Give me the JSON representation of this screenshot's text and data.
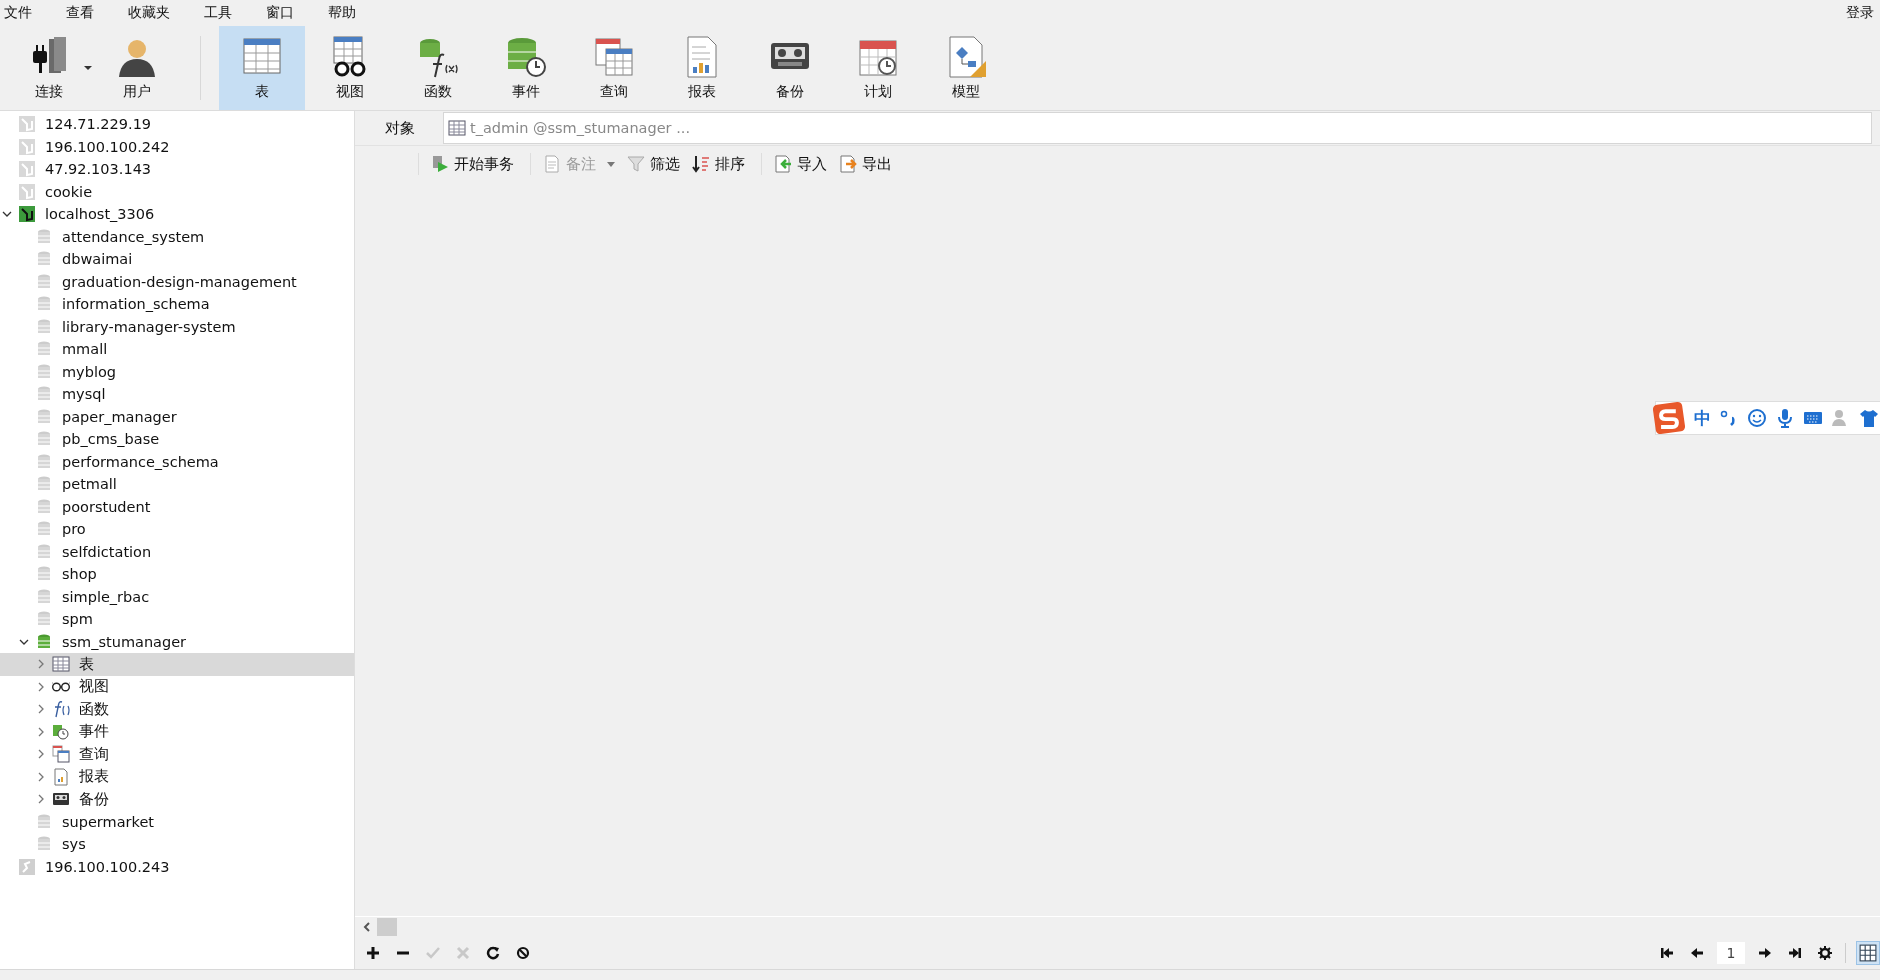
{
  "menu": [
    {
      "label": "文件"
    },
    {
      "label": "查看"
    },
    {
      "label": "收藏夹"
    },
    {
      "label": "工具"
    },
    {
      "label": "窗口"
    },
    {
      "label": "帮助"
    }
  ],
  "login": "登录",
  "toolbar": [
    {
      "label": "连接",
      "kind": "connection",
      "selected": false,
      "dropdown": true
    },
    {
      "label": "用户",
      "kind": "user",
      "selected": false,
      "dropdown": false
    },
    {
      "label": "表",
      "kind": "table",
      "selected": true,
      "dropdown": false
    },
    {
      "label": "视图",
      "kind": "view",
      "selected": false,
      "dropdown": false
    },
    {
      "label": "函数",
      "kind": "function",
      "selected": false,
      "dropdown": false
    },
    {
      "label": "事件",
      "kind": "event",
      "selected": false,
      "dropdown": false
    },
    {
      "label": "查询",
      "kind": "query",
      "selected": false,
      "dropdown": false
    },
    {
      "label": "报表",
      "kind": "report",
      "selected": false,
      "dropdown": false
    },
    {
      "label": "备份",
      "kind": "backup",
      "selected": false,
      "dropdown": false
    },
    {
      "label": "计划",
      "kind": "schedule",
      "selected": false,
      "dropdown": false
    },
    {
      "label": "模型",
      "kind": "model",
      "selected": false,
      "dropdown": false
    }
  ],
  "tree": [
    {
      "label": "124.71.229.19",
      "kind": "server",
      "selected": false
    },
    {
      "label": "196.100.100.242",
      "kind": "server",
      "selected": false
    },
    {
      "label": "47.92.103.143",
      "kind": "server",
      "selected": false
    },
    {
      "label": "cookie",
      "kind": "server",
      "selected": false
    },
    {
      "label": "localhost_3306",
      "kind": "server-open",
      "selected": false,
      "expanded": true,
      "children": [
        {
          "label": "attendance_system",
          "kind": "database",
          "selected": false
        },
        {
          "label": "dbwaimai",
          "kind": "database",
          "selected": false
        },
        {
          "label": "graduation-design-management",
          "kind": "database",
          "selected": false
        },
        {
          "label": "information_schema",
          "kind": "database",
          "selected": false
        },
        {
          "label": "library-manager-system",
          "kind": "database",
          "selected": false
        },
        {
          "label": "mmall",
          "kind": "database",
          "selected": false
        },
        {
          "label": "myblog",
          "kind": "database",
          "selected": false
        },
        {
          "label": "mysql",
          "kind": "database",
          "selected": false
        },
        {
          "label": "paper_manager",
          "kind": "database",
          "selected": false
        },
        {
          "label": "pb_cms_base",
          "kind": "database",
          "selected": false
        },
        {
          "label": "performance_schema",
          "kind": "database",
          "selected": false
        },
        {
          "label": "petmall",
          "kind": "database",
          "selected": false
        },
        {
          "label": "poorstudent",
          "kind": "database",
          "selected": false
        },
        {
          "label": "pro",
          "kind": "database",
          "selected": false
        },
        {
          "label": "selfdictation",
          "kind": "database",
          "selected": false
        },
        {
          "label": "shop",
          "kind": "database",
          "selected": false
        },
        {
          "label": "simple_rbac",
          "kind": "database",
          "selected": false
        },
        {
          "label": "spm",
          "kind": "database",
          "selected": false
        },
        {
          "label": "ssm_stumanager",
          "kind": "database-open",
          "selected": false,
          "expanded": true,
          "children": [
            {
              "label": "表",
              "kind": "table",
              "selected": true,
              "expanded": false
            },
            {
              "label": "视图",
              "kind": "view",
              "selected": false,
              "expanded": false
            },
            {
              "label": "函数",
              "kind": "function",
              "selected": false,
              "expanded": false
            },
            {
              "label": "事件",
              "kind": "event",
              "selected": false,
              "expanded": false
            },
            {
              "label": "查询",
              "kind": "query",
              "selected": false,
              "expanded": false
            },
            {
              "label": "报表",
              "kind": "report",
              "selected": false,
              "expanded": false
            },
            {
              "label": "备份",
              "kind": "backup",
              "selected": false,
              "expanded": false
            }
          ]
        },
        {
          "label": "supermarket",
          "kind": "database",
          "selected": false
        },
        {
          "label": "sys",
          "kind": "database",
          "selected": false
        }
      ]
    },
    {
      "label": "196.100.100.243",
      "kind": "server-other",
      "selected": false
    }
  ],
  "object_bar": {
    "label": "对象",
    "tab": "t_admin @ssm_stumanager ..."
  },
  "actions": [
    {
      "label": "开始事务",
      "kind": "transaction",
      "disabled": false,
      "dropdown": false
    },
    {
      "label": "备注",
      "kind": "note",
      "disabled": true,
      "dropdown": true
    },
    {
      "label": "筛选",
      "kind": "filter",
      "disabled": false,
      "dropdown": false
    },
    {
      "label": "排序",
      "kind": "sort",
      "disabled": false,
      "dropdown": false
    },
    {
      "label": "导入",
      "kind": "import",
      "disabled": false,
      "dropdown": false
    },
    {
      "label": "导出",
      "kind": "export",
      "disabled": false,
      "dropdown": false
    }
  ],
  "ime": {
    "mode": "中"
  },
  "record_buttons": [
    {
      "kind": "add",
      "disabled": false
    },
    {
      "kind": "remove",
      "disabled": false
    },
    {
      "kind": "apply",
      "disabled": true
    },
    {
      "kind": "discard",
      "disabled": true
    },
    {
      "kind": "refresh",
      "disabled": false
    },
    {
      "kind": "stop",
      "disabled": false
    }
  ],
  "pager": {
    "page": "1"
  }
}
